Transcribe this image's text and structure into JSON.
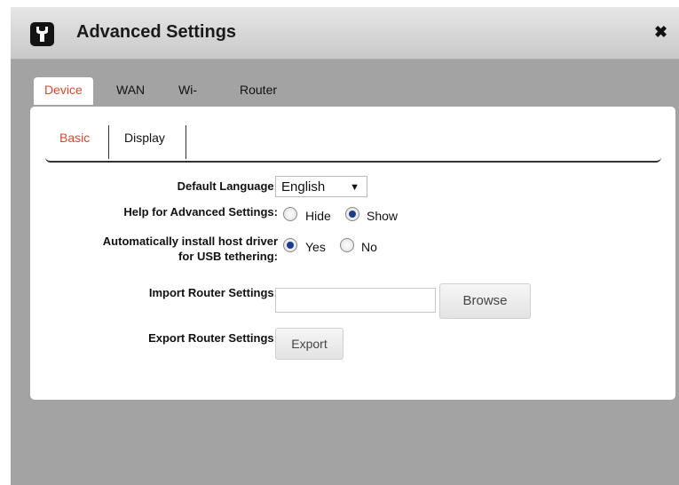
{
  "dialog": {
    "title": "Advanced Settings",
    "close": "✖"
  },
  "tabs": [
    "Device",
    "WAN",
    "Wi-Fi",
    "Router"
  ],
  "subtabs": [
    "Basic",
    "Display"
  ],
  "form": {
    "default_language_label": "Default Language:",
    "default_language_value": "English",
    "help_label": "Help for Advanced Settings:",
    "help_options": [
      "Hide",
      "Show"
    ],
    "help_selected": "Show",
    "usb_label_line1": "Automatically install host driver",
    "usb_label_line2": "for USB tethering:",
    "usb_options": [
      "Yes",
      "No"
    ],
    "usb_selected": "Yes",
    "import_label": "Import Router Settings:",
    "import_value": "",
    "browse_button": "Browse",
    "export_label": "Export Router Settings:",
    "export_button": "Export"
  },
  "colors": {
    "accent": "#e0452b",
    "background": "#a3a3a3"
  },
  "icons": {
    "title": "wrench-icon",
    "close": "close-icon"
  }
}
